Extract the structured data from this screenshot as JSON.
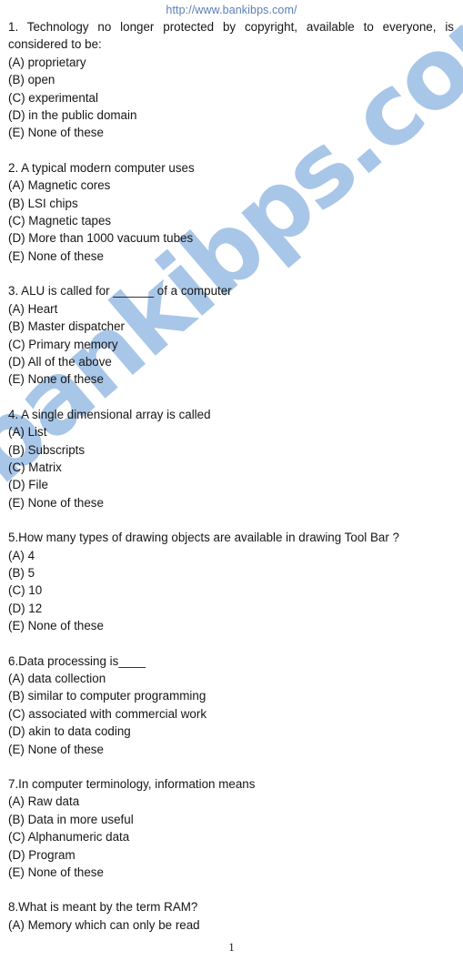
{
  "header": {
    "site_url": "http://www.bankibps.com/"
  },
  "watermark": {
    "text": "bankibps.com",
    "color": "#a8c6e8",
    "rotation_deg": -40.5
  },
  "footer": {
    "page_number": "1"
  },
  "colors": {
    "url_blue": "#5b7fb8",
    "body_text": "#161616",
    "page_background": "#ffffff"
  },
  "questions": [
    {
      "stem": "1. Technology no longer protected by copyright, available to everyone, is considered to be:",
      "justified": true,
      "options": [
        "(A) proprietary",
        "(B) open",
        "(C) experimental",
        "(D) in the public domain",
        "(E) None of these"
      ]
    },
    {
      "stem": "2. A typical modern computer uses",
      "justified": false,
      "options": [
        "(A) Magnetic cores",
        "(B) LSI chips",
        "(C) Magnetic tapes",
        "(D) More than 1000 vacuum tubes",
        "(E) None of these"
      ]
    },
    {
      "stem": "3. ALU is called for ______ of a computer",
      "justified": false,
      "options": [
        "(A) Heart",
        "(B) Master dispatcher",
        "(C) Primary memory",
        "(D) All of the above",
        "(E) None of these"
      ]
    },
    {
      "stem": "4. A single dimensional array is called",
      "justified": false,
      "options": [
        "(A) List",
        "(B) Subscripts",
        "(C) Matrix",
        "(D) File",
        "(E) None of these"
      ]
    },
    {
      "stem": "5.How many types of drawing objects are available in drawing Tool Bar ?",
      "justified": false,
      "options": [
        "(A) 4",
        "(B) 5",
        "(C) 10",
        "(D) 12",
        "(E) None of these"
      ]
    },
    {
      "stem": "6.Data processing is____",
      "justified": false,
      "options": [
        "(A) data collection",
        "(B) similar to computer programming",
        "(C) associated with commercial work",
        "(D) akin to data coding",
        "(E) None of these"
      ]
    },
    {
      "stem": "7.In computer terminology, information means",
      "justified": false,
      "options": [
        "(A) Raw data",
        "(B) Data in more useful",
        "(C) Alphanumeric data",
        "(D) Program",
        "(E) None of these"
      ]
    },
    {
      "stem": "8.What is meant by the term RAM?",
      "justified": false,
      "options": [
        "(A) Memory which can only be read"
      ]
    }
  ]
}
